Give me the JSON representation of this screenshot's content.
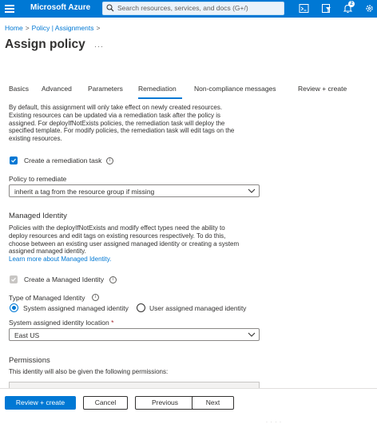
{
  "topbar": {
    "brand": "Microsoft Azure",
    "search_placeholder": "Search resources, services, and docs (G+/)",
    "notification_count": "2",
    "accent_color": "#0078d4",
    "icons": [
      "menu-icon",
      "search-icon",
      "cloud-shell-icon",
      "directory-filter-icon",
      "notifications-icon",
      "settings-icon"
    ]
  },
  "breadcrumb": {
    "items": [
      "Home",
      "Policy | Assignments"
    ],
    "separator": ">"
  },
  "page": {
    "title": "Assign policy",
    "more_label": "···"
  },
  "tabs": {
    "items": [
      "Basics",
      "Advanced",
      "Parameters",
      "Remediation",
      "Non-compliance messages",
      "Review + create"
    ],
    "active": "Remediation"
  },
  "remediation": {
    "intro_lines": [
      "By default, this assignment will only take effect on newly created resources.",
      "Existing resources can be updated via a remediation task after the policy is",
      "assigned. For deployIfNotExists policies, the remediation task will deploy the",
      "specified template. For modify policies, the remediation task will edit tags on the",
      "existing resources."
    ],
    "create_task_label": "Create a remediation task",
    "create_task_checked": true,
    "policy_to_remediate_label": "Policy to remediate",
    "policy_to_remediate_value": "inherit a tag from the resource group if missing"
  },
  "managed_identity": {
    "heading": "Managed Identity",
    "description_lines": [
      "Policies with the deployIfNotExists and modify effect types need the ability to",
      "deploy resources and edit tags on existing resources respectively. To do this,",
      "choose between an existing user assigned managed identity or creating a system",
      "assigned managed identity."
    ],
    "learn_more_link": "Learn more about Managed Identity.",
    "create_identity_label": "Create a Managed Identity",
    "create_identity_checked": true,
    "type_label": "Type of Managed Identity",
    "type_options": [
      "System assigned managed identity",
      "User assigned managed identity"
    ],
    "type_selected": "System assigned managed identity",
    "location_label": "System assigned identity location",
    "location_required_mark": "*",
    "location_value": "East US"
  },
  "permissions": {
    "heading": "Permissions",
    "description": "This identity will also be given the following permissions:"
  },
  "footer": {
    "review_create": "Review + create",
    "cancel": "Cancel",
    "previous": "Previous",
    "next": "Next",
    "resize_grip": "· · · ·"
  }
}
